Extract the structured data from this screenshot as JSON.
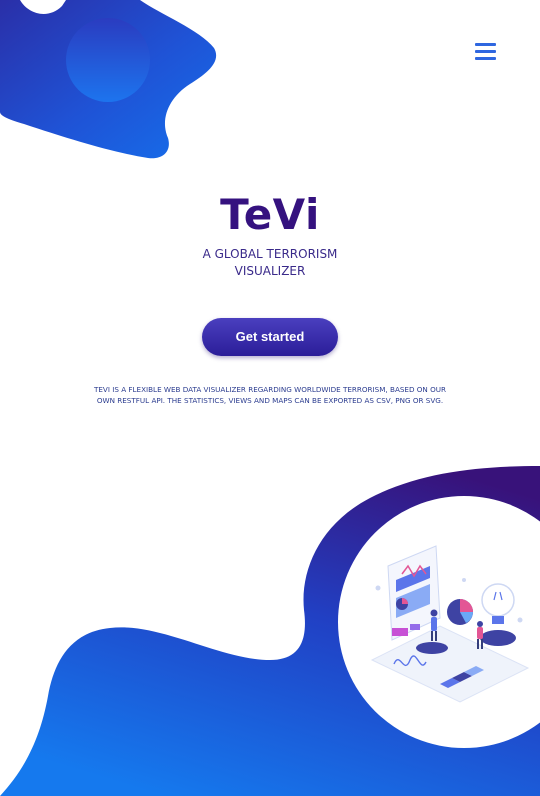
{
  "header": {
    "menu_icon": "hamburger-menu-icon",
    "accent_color": "#2f67e0"
  },
  "hero": {
    "title": "TeVi",
    "tagline": "A GLOBAL TERRORISM VISUALIZER",
    "cta_label": "Get started",
    "description": "TEVI IS A FLEXIBLE WEB DATA VISUALIZER REGARDING WORLDWIDE TERRORISM, BASED ON OUR OWN RESTFUL API. THE STATISTICS, VIEWS AND MAPS CAN BE EXPORTED AS CSV, PNG OR SVG."
  },
  "illustration": {
    "icon": "data-analytics-illustration",
    "brand_gradient": [
      "#35127f",
      "#1e4fd6",
      "#137cf0"
    ]
  }
}
